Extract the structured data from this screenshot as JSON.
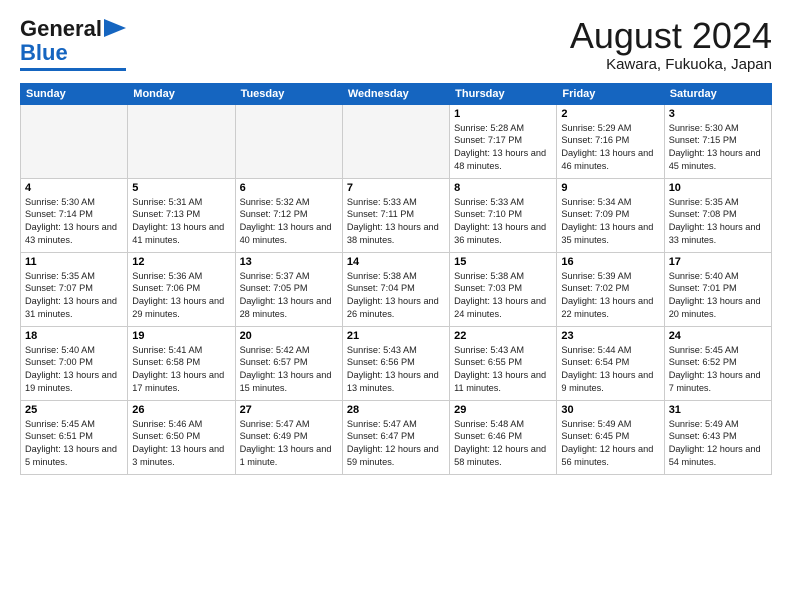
{
  "logo": {
    "line1": "General",
    "line2": "Blue"
  },
  "title": "August 2024",
  "location": "Kawara, Fukuoka, Japan",
  "weekdays": [
    "Sunday",
    "Monday",
    "Tuesday",
    "Wednesday",
    "Thursday",
    "Friday",
    "Saturday"
  ],
  "weeks": [
    [
      {
        "day": "",
        "info": ""
      },
      {
        "day": "",
        "info": ""
      },
      {
        "day": "",
        "info": ""
      },
      {
        "day": "",
        "info": ""
      },
      {
        "day": "1",
        "info": "Sunrise: 5:28 AM\nSunset: 7:17 PM\nDaylight: 13 hours\nand 48 minutes."
      },
      {
        "day": "2",
        "info": "Sunrise: 5:29 AM\nSunset: 7:16 PM\nDaylight: 13 hours\nand 46 minutes."
      },
      {
        "day": "3",
        "info": "Sunrise: 5:30 AM\nSunset: 7:15 PM\nDaylight: 13 hours\nand 45 minutes."
      }
    ],
    [
      {
        "day": "4",
        "info": "Sunrise: 5:30 AM\nSunset: 7:14 PM\nDaylight: 13 hours\nand 43 minutes."
      },
      {
        "day": "5",
        "info": "Sunrise: 5:31 AM\nSunset: 7:13 PM\nDaylight: 13 hours\nand 41 minutes."
      },
      {
        "day": "6",
        "info": "Sunrise: 5:32 AM\nSunset: 7:12 PM\nDaylight: 13 hours\nand 40 minutes."
      },
      {
        "day": "7",
        "info": "Sunrise: 5:33 AM\nSunset: 7:11 PM\nDaylight: 13 hours\nand 38 minutes."
      },
      {
        "day": "8",
        "info": "Sunrise: 5:33 AM\nSunset: 7:10 PM\nDaylight: 13 hours\nand 36 minutes."
      },
      {
        "day": "9",
        "info": "Sunrise: 5:34 AM\nSunset: 7:09 PM\nDaylight: 13 hours\nand 35 minutes."
      },
      {
        "day": "10",
        "info": "Sunrise: 5:35 AM\nSunset: 7:08 PM\nDaylight: 13 hours\nand 33 minutes."
      }
    ],
    [
      {
        "day": "11",
        "info": "Sunrise: 5:35 AM\nSunset: 7:07 PM\nDaylight: 13 hours\nand 31 minutes."
      },
      {
        "day": "12",
        "info": "Sunrise: 5:36 AM\nSunset: 7:06 PM\nDaylight: 13 hours\nand 29 minutes."
      },
      {
        "day": "13",
        "info": "Sunrise: 5:37 AM\nSunset: 7:05 PM\nDaylight: 13 hours\nand 28 minutes."
      },
      {
        "day": "14",
        "info": "Sunrise: 5:38 AM\nSunset: 7:04 PM\nDaylight: 13 hours\nand 26 minutes."
      },
      {
        "day": "15",
        "info": "Sunrise: 5:38 AM\nSunset: 7:03 PM\nDaylight: 13 hours\nand 24 minutes."
      },
      {
        "day": "16",
        "info": "Sunrise: 5:39 AM\nSunset: 7:02 PM\nDaylight: 13 hours\nand 22 minutes."
      },
      {
        "day": "17",
        "info": "Sunrise: 5:40 AM\nSunset: 7:01 PM\nDaylight: 13 hours\nand 20 minutes."
      }
    ],
    [
      {
        "day": "18",
        "info": "Sunrise: 5:40 AM\nSunset: 7:00 PM\nDaylight: 13 hours\nand 19 minutes."
      },
      {
        "day": "19",
        "info": "Sunrise: 5:41 AM\nSunset: 6:58 PM\nDaylight: 13 hours\nand 17 minutes."
      },
      {
        "day": "20",
        "info": "Sunrise: 5:42 AM\nSunset: 6:57 PM\nDaylight: 13 hours\nand 15 minutes."
      },
      {
        "day": "21",
        "info": "Sunrise: 5:43 AM\nSunset: 6:56 PM\nDaylight: 13 hours\nand 13 minutes."
      },
      {
        "day": "22",
        "info": "Sunrise: 5:43 AM\nSunset: 6:55 PM\nDaylight: 13 hours\nand 11 minutes."
      },
      {
        "day": "23",
        "info": "Sunrise: 5:44 AM\nSunset: 6:54 PM\nDaylight: 13 hours\nand 9 minutes."
      },
      {
        "day": "24",
        "info": "Sunrise: 5:45 AM\nSunset: 6:52 PM\nDaylight: 13 hours\nand 7 minutes."
      }
    ],
    [
      {
        "day": "25",
        "info": "Sunrise: 5:45 AM\nSunset: 6:51 PM\nDaylight: 13 hours\nand 5 minutes."
      },
      {
        "day": "26",
        "info": "Sunrise: 5:46 AM\nSunset: 6:50 PM\nDaylight: 13 hours\nand 3 minutes."
      },
      {
        "day": "27",
        "info": "Sunrise: 5:47 AM\nSunset: 6:49 PM\nDaylight: 13 hours\nand 1 minute."
      },
      {
        "day": "28",
        "info": "Sunrise: 5:47 AM\nSunset: 6:47 PM\nDaylight: 12 hours\nand 59 minutes."
      },
      {
        "day": "29",
        "info": "Sunrise: 5:48 AM\nSunset: 6:46 PM\nDaylight: 12 hours\nand 58 minutes."
      },
      {
        "day": "30",
        "info": "Sunrise: 5:49 AM\nSunset: 6:45 PM\nDaylight: 12 hours\nand 56 minutes."
      },
      {
        "day": "31",
        "info": "Sunrise: 5:49 AM\nSunset: 6:43 PM\nDaylight: 12 hours\nand 54 minutes."
      }
    ]
  ]
}
